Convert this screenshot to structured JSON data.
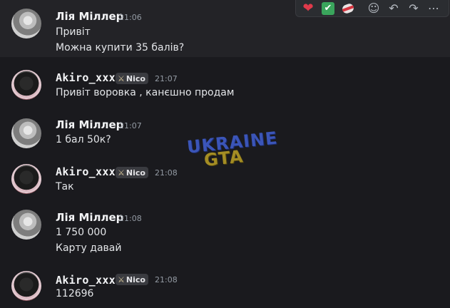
{
  "watermark": {
    "top": "UKRAINE",
    "bottom": "GTA"
  },
  "toolbar": {
    "reactions": [
      {
        "icon": "heart-icon",
        "symbol": "❤"
      },
      {
        "icon": "check-icon",
        "symbol": "✔"
      },
      {
        "icon": "bandage-icon",
        "symbol": ""
      }
    ],
    "actions": [
      {
        "icon": "add-reaction-icon",
        "symbol": "☺"
      },
      {
        "icon": "reply-icon",
        "symbol": "↶"
      },
      {
        "icon": "forward-icon",
        "symbol": "↷"
      },
      {
        "icon": "more-icon",
        "symbol": "⋯"
      }
    ]
  },
  "messages": [
    {
      "author": "Лія Міллер",
      "time": "21:06",
      "lines": [
        "Привіт",
        "Можна купити 35 балів?"
      ]
    },
    {
      "author": "Akiro_xxx",
      "badge": "Nico",
      "time": "21:07",
      "lines": [
        "Привіт воровка , канєшно продам"
      ]
    },
    {
      "author": "Лія Міллер",
      "time": "21:07",
      "lines": [
        "1 бал 50к?"
      ]
    },
    {
      "author": "Akiro_xxx",
      "badge": "Nico",
      "time": "21:08",
      "lines": [
        "Так"
      ]
    },
    {
      "author": "Лія Міллер",
      "time": "21:08",
      "lines": [
        "1 750 000",
        "Карту давай"
      ]
    },
    {
      "author": "Akiro_xxx",
      "badge": "Nico",
      "time": "21:08",
      "lines": [
        "112696"
      ]
    }
  ]
}
